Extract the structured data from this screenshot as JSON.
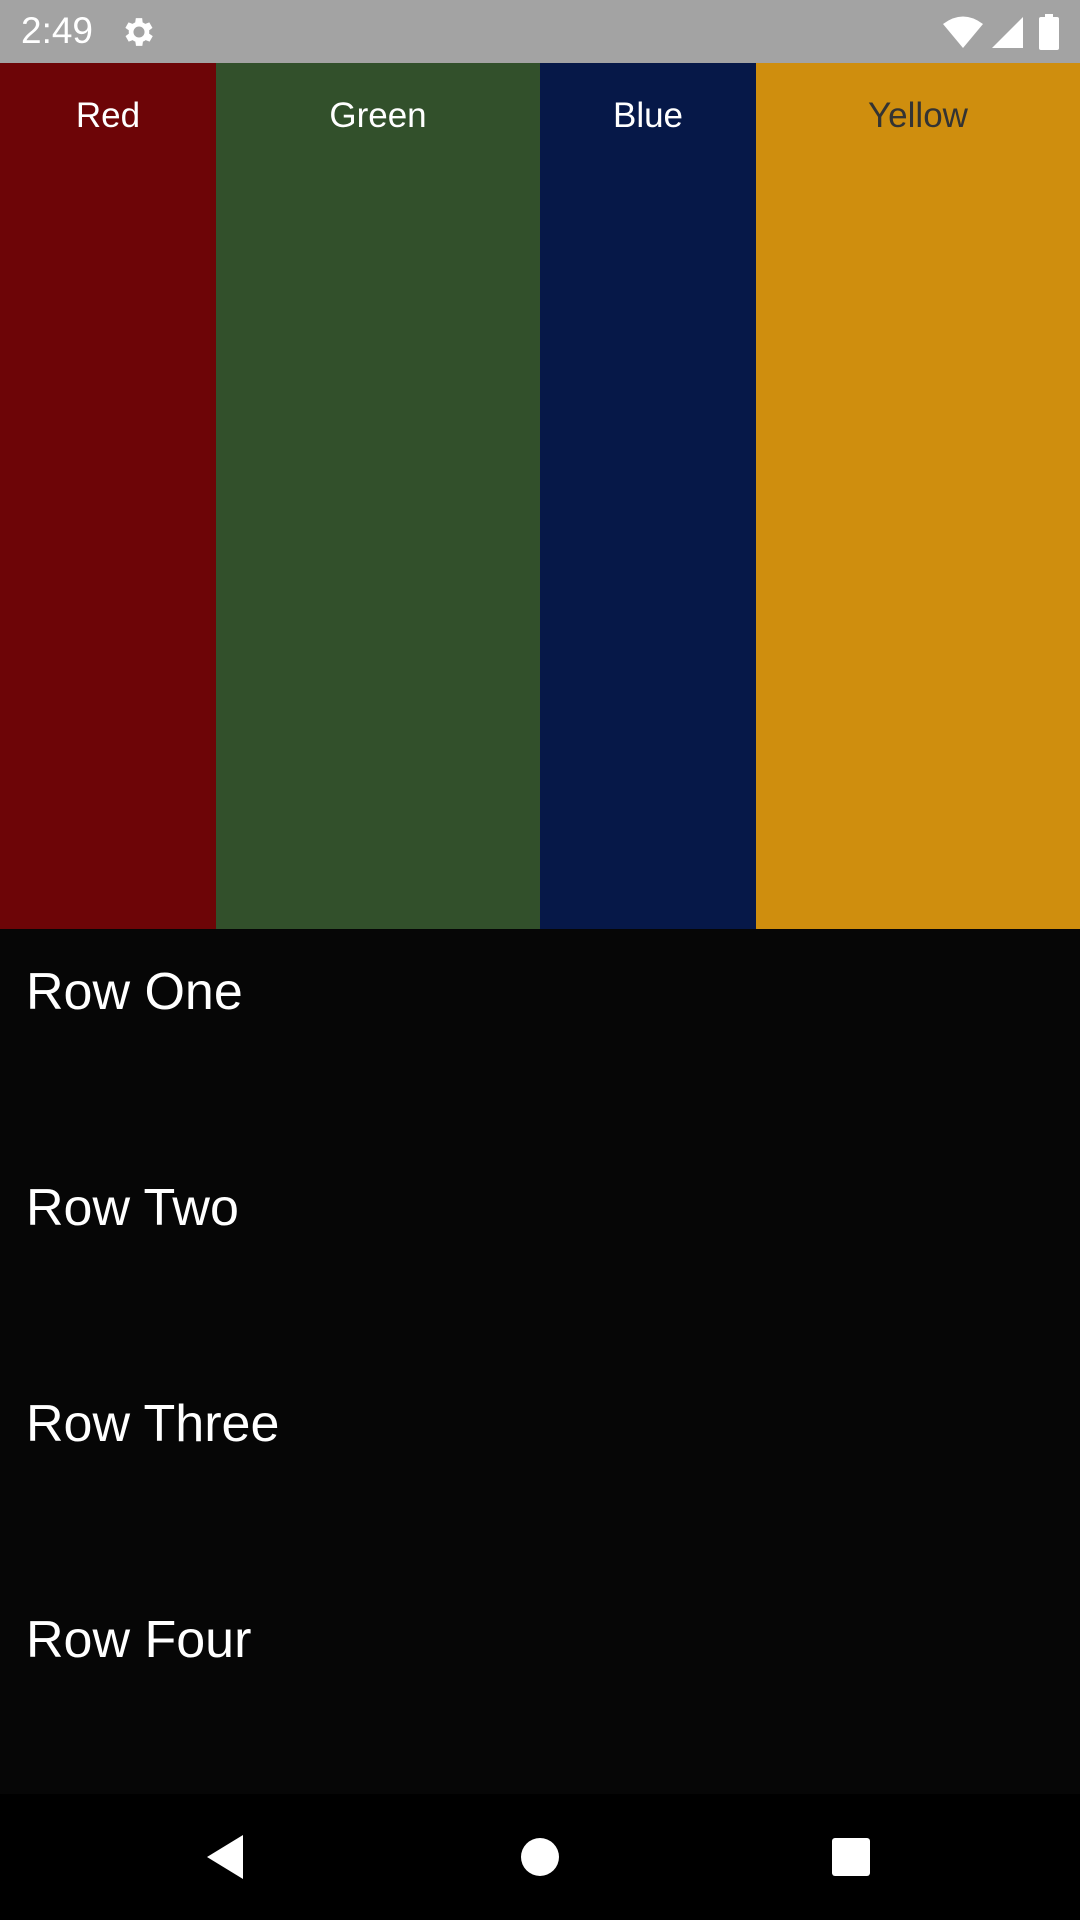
{
  "status_bar": {
    "time": "2:49",
    "background": "#a3a3a3",
    "icons": [
      "settings-gear-icon",
      "wifi-icon",
      "cell-signal-icon",
      "battery-icon"
    ]
  },
  "columns": [
    {
      "label": "Red",
      "color": "#6d0507",
      "text_color": "#ffffff"
    },
    {
      "label": "Green",
      "color": "#32502b",
      "text_color": "#ffffff"
    },
    {
      "label": "Blue",
      "color": "#061848",
      "text_color": "#ffffff"
    },
    {
      "label": "Yellow",
      "color": "#cf8e0e",
      "text_color": "#333333"
    }
  ],
  "rows": [
    {
      "label": "Row One"
    },
    {
      "label": "Row Two"
    },
    {
      "label": "Row Three"
    },
    {
      "label": "Row Four"
    }
  ],
  "nav_bar": {
    "icons": [
      "back-triangle-icon",
      "home-circle-icon",
      "recents-square-icon"
    ]
  }
}
